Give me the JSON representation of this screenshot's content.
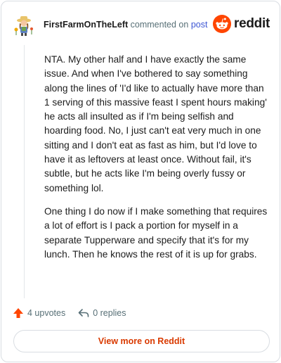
{
  "header": {
    "username": "FirstFarmOnTheLeft",
    "commented_text": "commented on",
    "post_link": "post",
    "brand_name": "reddit"
  },
  "comment": {
    "paragraphs": [
      "NTA. My other half and I have exactly the same issue. And when I've bothered to say something along the lines of 'I'd like to actually have more than 1 serving of this massive feast I spent hours making' he acts all insulted as if I'm being selfish and hoarding food. No, I just can't eat very much in one sitting and I don't eat as fast as him, but I'd love to have it as leftovers at least once. Without fail, it's subtle, but he acts like I'm being overly fussy or something lol.",
      "One thing I do now if I make something that requires a lot of effort is I pack a portion for myself in a separate Tupperware and specify that it's for my lunch. Then he knows the rest of it is up for grabs."
    ]
  },
  "actions": {
    "upvotes": "4 upvotes",
    "replies": "0 replies"
  },
  "footer": {
    "view_more": "View more on Reddit"
  },
  "colors": {
    "accent_orange": "#ff4500",
    "link_blue": "#3e57d4",
    "view_more_text": "#d93a00",
    "muted_text": "#576f76"
  },
  "icons": [
    "avatar-farmer-icon",
    "reddit-snoo-icon",
    "upvote-arrow-icon",
    "reply-arrow-icon"
  ]
}
